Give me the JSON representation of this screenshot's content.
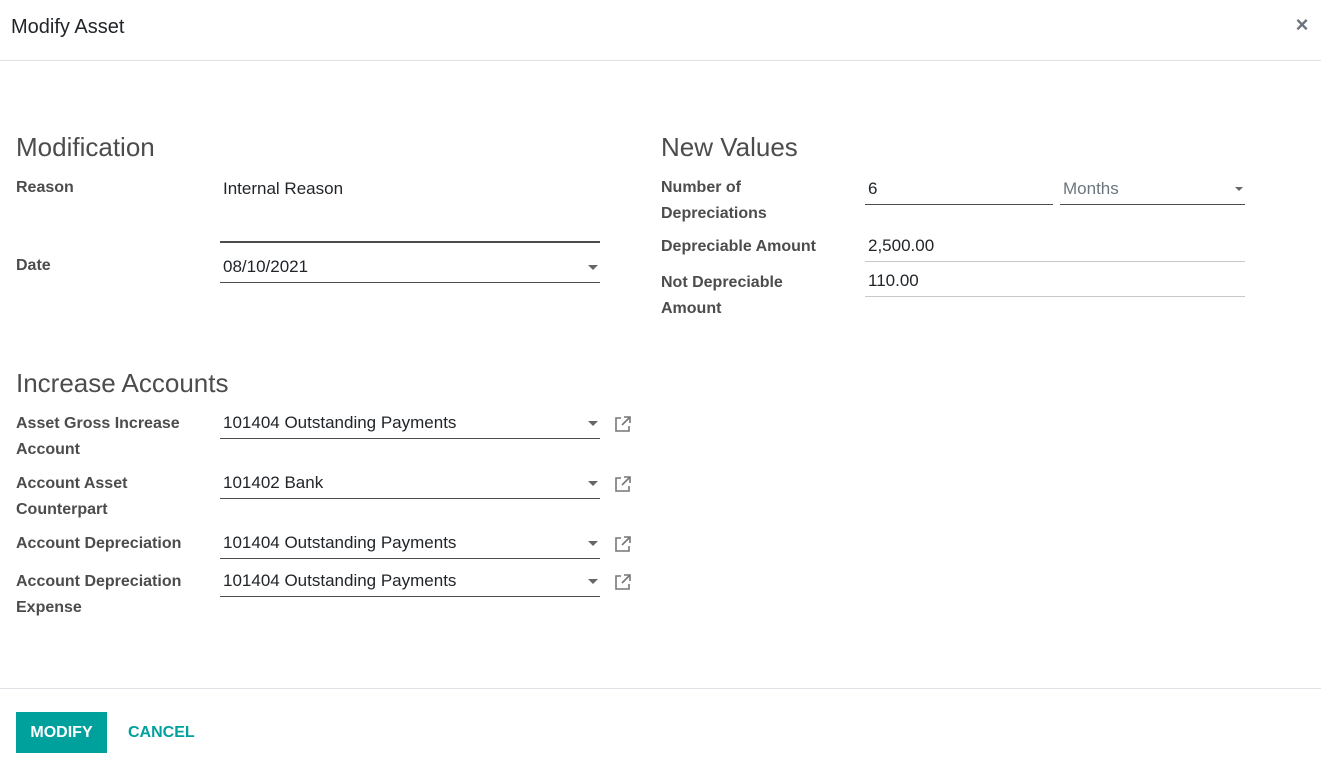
{
  "dialog": {
    "title": "Modify Asset",
    "close_symbol": "×"
  },
  "modification": {
    "heading": "Modification",
    "reason_label": "Reason",
    "reason_value": "Internal Reason",
    "date_label": "Date",
    "date_value": "08/10/2021"
  },
  "new_values": {
    "heading": "New Values",
    "num_depreciations_label": "Number of Depreciations",
    "num_depreciations_value": "6",
    "period_unit": "Months",
    "depreciable_amount_label": "Depreciable Amount",
    "depreciable_amount_value": "2,500.00",
    "not_depreciable_label": "Not Depreciable Amount",
    "not_depreciable_value": "110.00"
  },
  "increase_accounts": {
    "heading": "Increase Accounts",
    "rows": [
      {
        "label": "Asset Gross Increase Account",
        "value": "101404 Outstanding Payments"
      },
      {
        "label": "Account Asset Counterpart",
        "value": "101402 Bank"
      },
      {
        "label": "Account Depreciation",
        "value": "101404 Outstanding Payments"
      },
      {
        "label": "Account Depreciation Expense",
        "value": "101404 Outstanding Payments"
      }
    ]
  },
  "footer": {
    "modify_label": "MODIFY",
    "cancel_label": "CANCEL"
  },
  "icons": {
    "close": "close-icon",
    "dropdown": "chevron-down-icon",
    "external": "external-link-icon"
  },
  "colors": {
    "primary": "#00a09d",
    "label": "#4c4c4c",
    "text": "#212529"
  }
}
